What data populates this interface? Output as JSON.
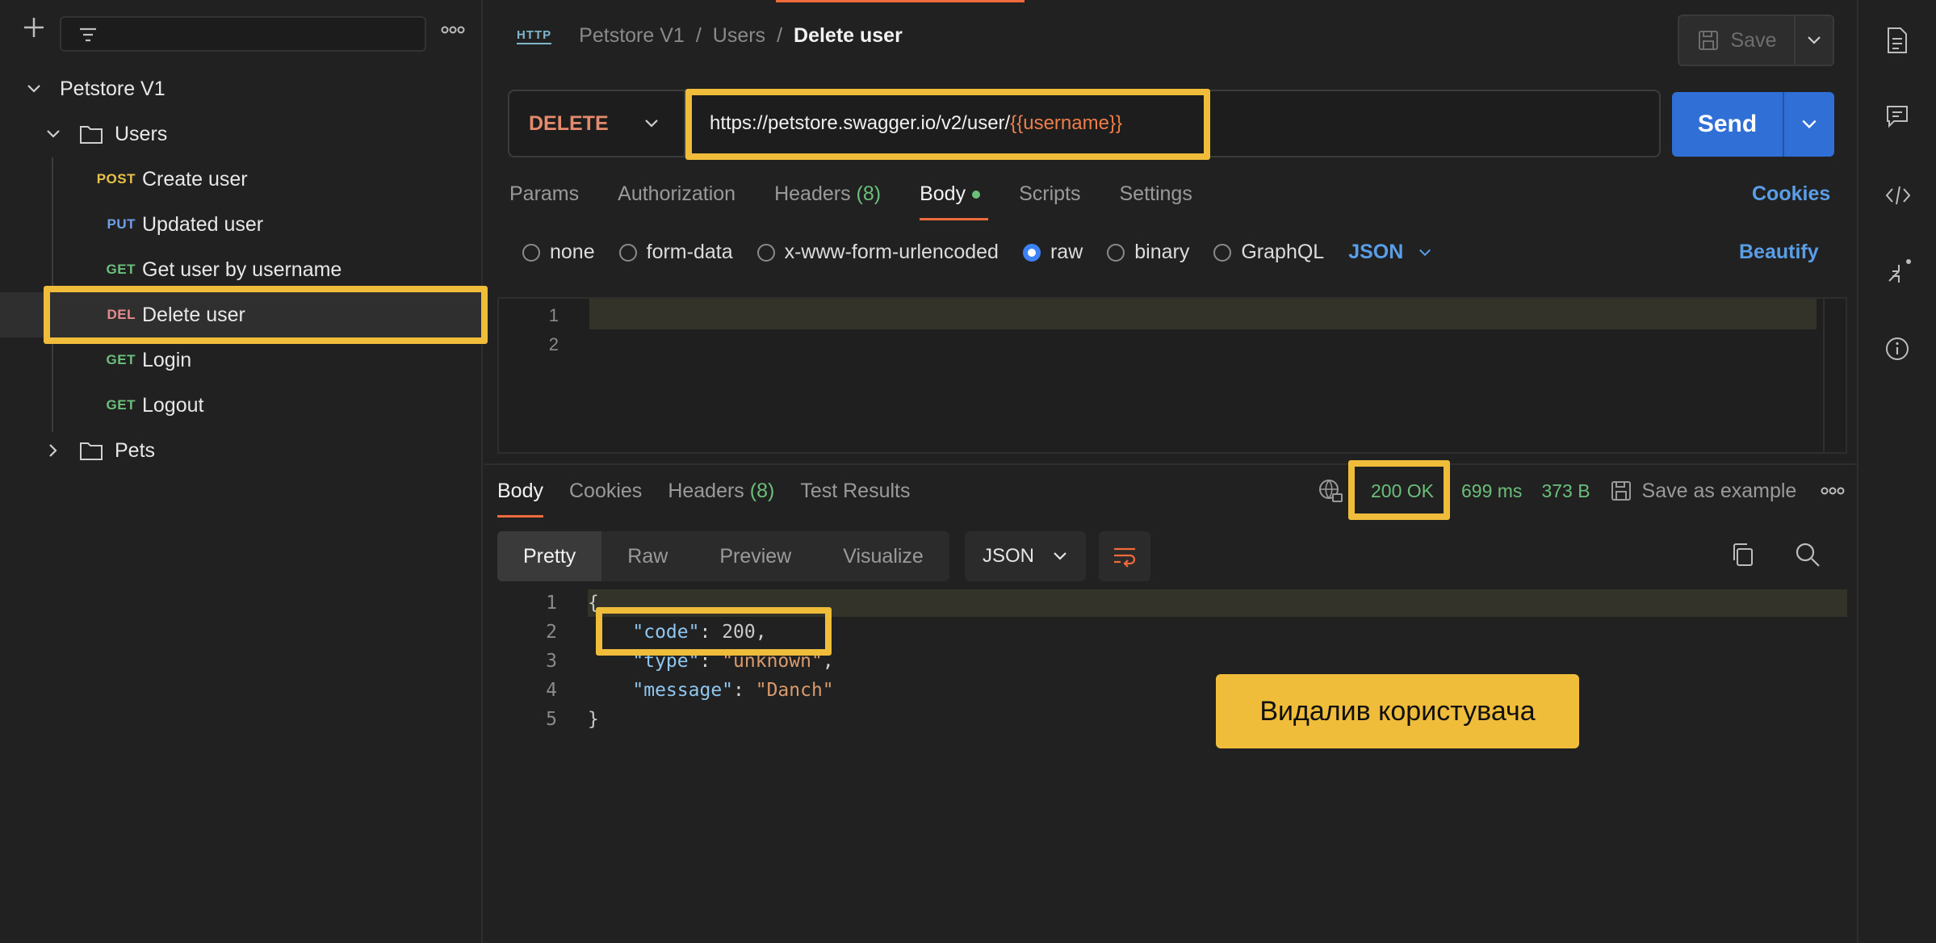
{
  "sidebar": {
    "collection": "Petstore V1",
    "folders": [
      {
        "name": "Users",
        "expanded": true
      },
      {
        "name": "Pets",
        "expanded": false
      }
    ],
    "requests": [
      {
        "method": "POST",
        "name": "Create user"
      },
      {
        "method": "PUT",
        "name": "Updated user"
      },
      {
        "method": "GET",
        "name": "Get user by username"
      },
      {
        "method": "DEL",
        "name": "Delete user",
        "selected": true
      },
      {
        "method": "GET",
        "name": "Login"
      },
      {
        "method": "GET",
        "name": "Logout"
      }
    ]
  },
  "header": {
    "http_label": "HTTP",
    "breadcrumb": [
      "Petstore V1",
      "Users",
      "Delete user"
    ],
    "save_label": "Save"
  },
  "request": {
    "method": "DELETE",
    "url_base": "https://petstore.swagger.io/v2/user/",
    "url_var": "{{username}}",
    "send_label": "Send",
    "tabs": [
      {
        "label": "Params"
      },
      {
        "label": "Authorization"
      },
      {
        "label": "Headers",
        "count": "(8)"
      },
      {
        "label": "Body",
        "active": true,
        "dot": true
      },
      {
        "label": "Scripts"
      },
      {
        "label": "Settings"
      }
    ],
    "cookies_label": "Cookies",
    "body_types": [
      "none",
      "form-data",
      "x-www-form-urlencoded",
      "raw",
      "binary",
      "GraphQL"
    ],
    "body_type_selected": "raw",
    "body_format": "JSON",
    "beautify_label": "Beautify",
    "editor_lines": [
      "1",
      "2"
    ]
  },
  "response": {
    "tabs": [
      {
        "label": "Body",
        "active": true
      },
      {
        "label": "Cookies"
      },
      {
        "label": "Headers",
        "count": "(8)"
      },
      {
        "label": "Test Results"
      }
    ],
    "status": "200 OK",
    "time": "699 ms",
    "size": "373 B",
    "save_example_label": "Save as example",
    "view_tabs": [
      "Pretty",
      "Raw",
      "Preview",
      "Visualize"
    ],
    "view_selected": "Pretty",
    "format": "JSON",
    "body_lines": [
      {
        "no": "1",
        "text": "{"
      },
      {
        "no": "2",
        "key": "\"code\"",
        "value": "200",
        "trail": ","
      },
      {
        "no": "3",
        "key": "\"type\"",
        "value": "\"unknown\"",
        "trail": ","
      },
      {
        "no": "4",
        "key": "\"message\"",
        "value": "\"Danch\"",
        "trail": ""
      },
      {
        "no": "5",
        "text": "}"
      }
    ]
  },
  "annotation": {
    "callout_text": "Видалив користувача"
  },
  "colors": {
    "highlight": "#f0bd3a",
    "accent": "#ef6b3b",
    "send": "#2f6fd6",
    "link": "#5a9ee8",
    "success": "#6bbf7a"
  }
}
